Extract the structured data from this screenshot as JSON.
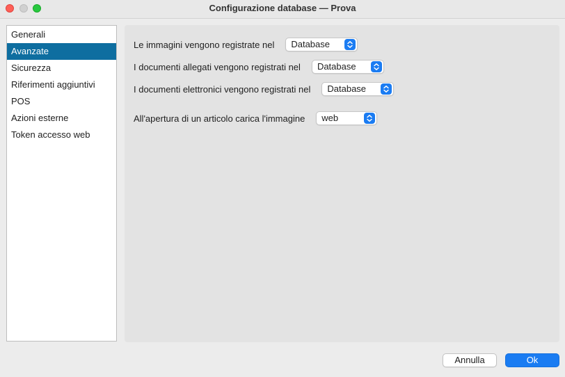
{
  "window": {
    "title": "Configurazione database — Prova"
  },
  "sidebar": {
    "items": [
      {
        "label": "Generali"
      },
      {
        "label": "Avanzate"
      },
      {
        "label": "Sicurezza"
      },
      {
        "label": "Riferimenti aggiuntivi"
      },
      {
        "label": "POS"
      },
      {
        "label": "Azioni esterne"
      },
      {
        "label": "Token accesso web"
      }
    ],
    "selected": "Avanzate"
  },
  "settings": {
    "images": {
      "label": "Le immagini vengono registrate nel",
      "value": "Database"
    },
    "attachments": {
      "label": "I documenti allegati vengono registrati nel",
      "value": "Database"
    },
    "electronic": {
      "label": "I documenti elettronici vengono registrati nel",
      "value": "Database"
    },
    "open_image": {
      "label": "All'apertura di un articolo carica l'immagine",
      "value": "web"
    }
  },
  "buttons": {
    "cancel": "Annulla",
    "ok": "Ok"
  },
  "colors": {
    "accent": "#1a7cf2",
    "selection": "#0e6ea0"
  }
}
